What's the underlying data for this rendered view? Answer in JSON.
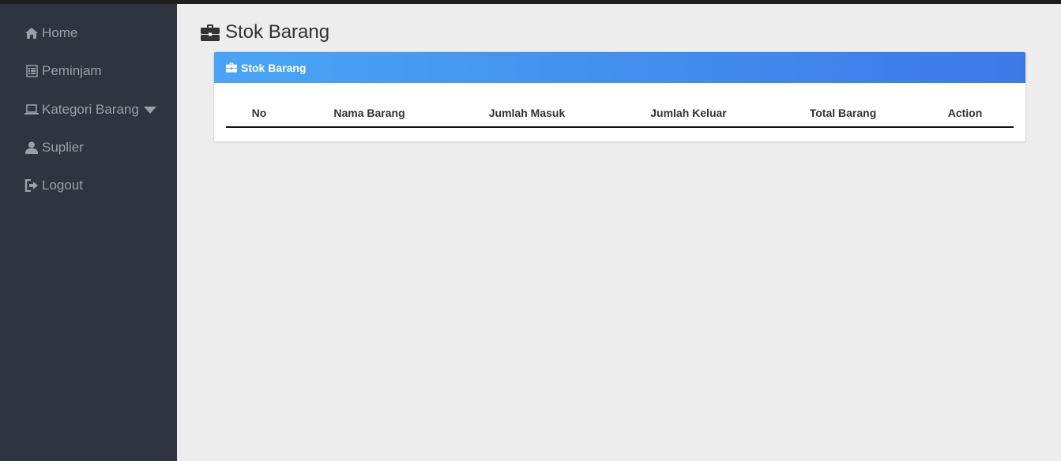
{
  "sidebar": {
    "items": [
      {
        "label": "Home",
        "icon": "home-icon"
      },
      {
        "label": "Peminjam",
        "icon": "list-icon"
      },
      {
        "label": "Kategori Barang",
        "icon": "laptop-icon",
        "has_dropdown": true
      },
      {
        "label": "Suplier",
        "icon": "user-icon"
      },
      {
        "label": "Logout",
        "icon": "logout-icon"
      }
    ]
  },
  "page": {
    "title": "Stok Barang",
    "title_icon": "briefcase-icon"
  },
  "panel": {
    "title": "Stok Barang",
    "title_icon": "briefcase-icon",
    "header_gradient": [
      "#4aa5f6",
      "#3c79e8"
    ]
  },
  "table": {
    "columns": [
      "No",
      "Nama Barang",
      "Jumlah Masuk",
      "Jumlah Keluar",
      "Total Barang",
      "Action"
    ],
    "rows": []
  },
  "colors": {
    "sidebar_bg": "#2e3440",
    "sidebar_text": "#9aa0a6",
    "page_bg": "#ededed"
  }
}
